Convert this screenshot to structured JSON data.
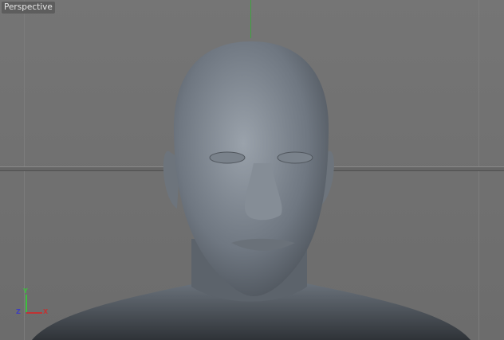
{
  "viewport": {
    "label": "Perspective"
  },
  "axis_gizmo": {
    "x": "X",
    "y": "Y",
    "z": "Z",
    "colors": {
      "x": "#c03434",
      "y": "#3fbf3f",
      "z": "#3c3cc0"
    }
  },
  "model": {
    "name": "human-head-mesh",
    "color": "#7d8690"
  }
}
